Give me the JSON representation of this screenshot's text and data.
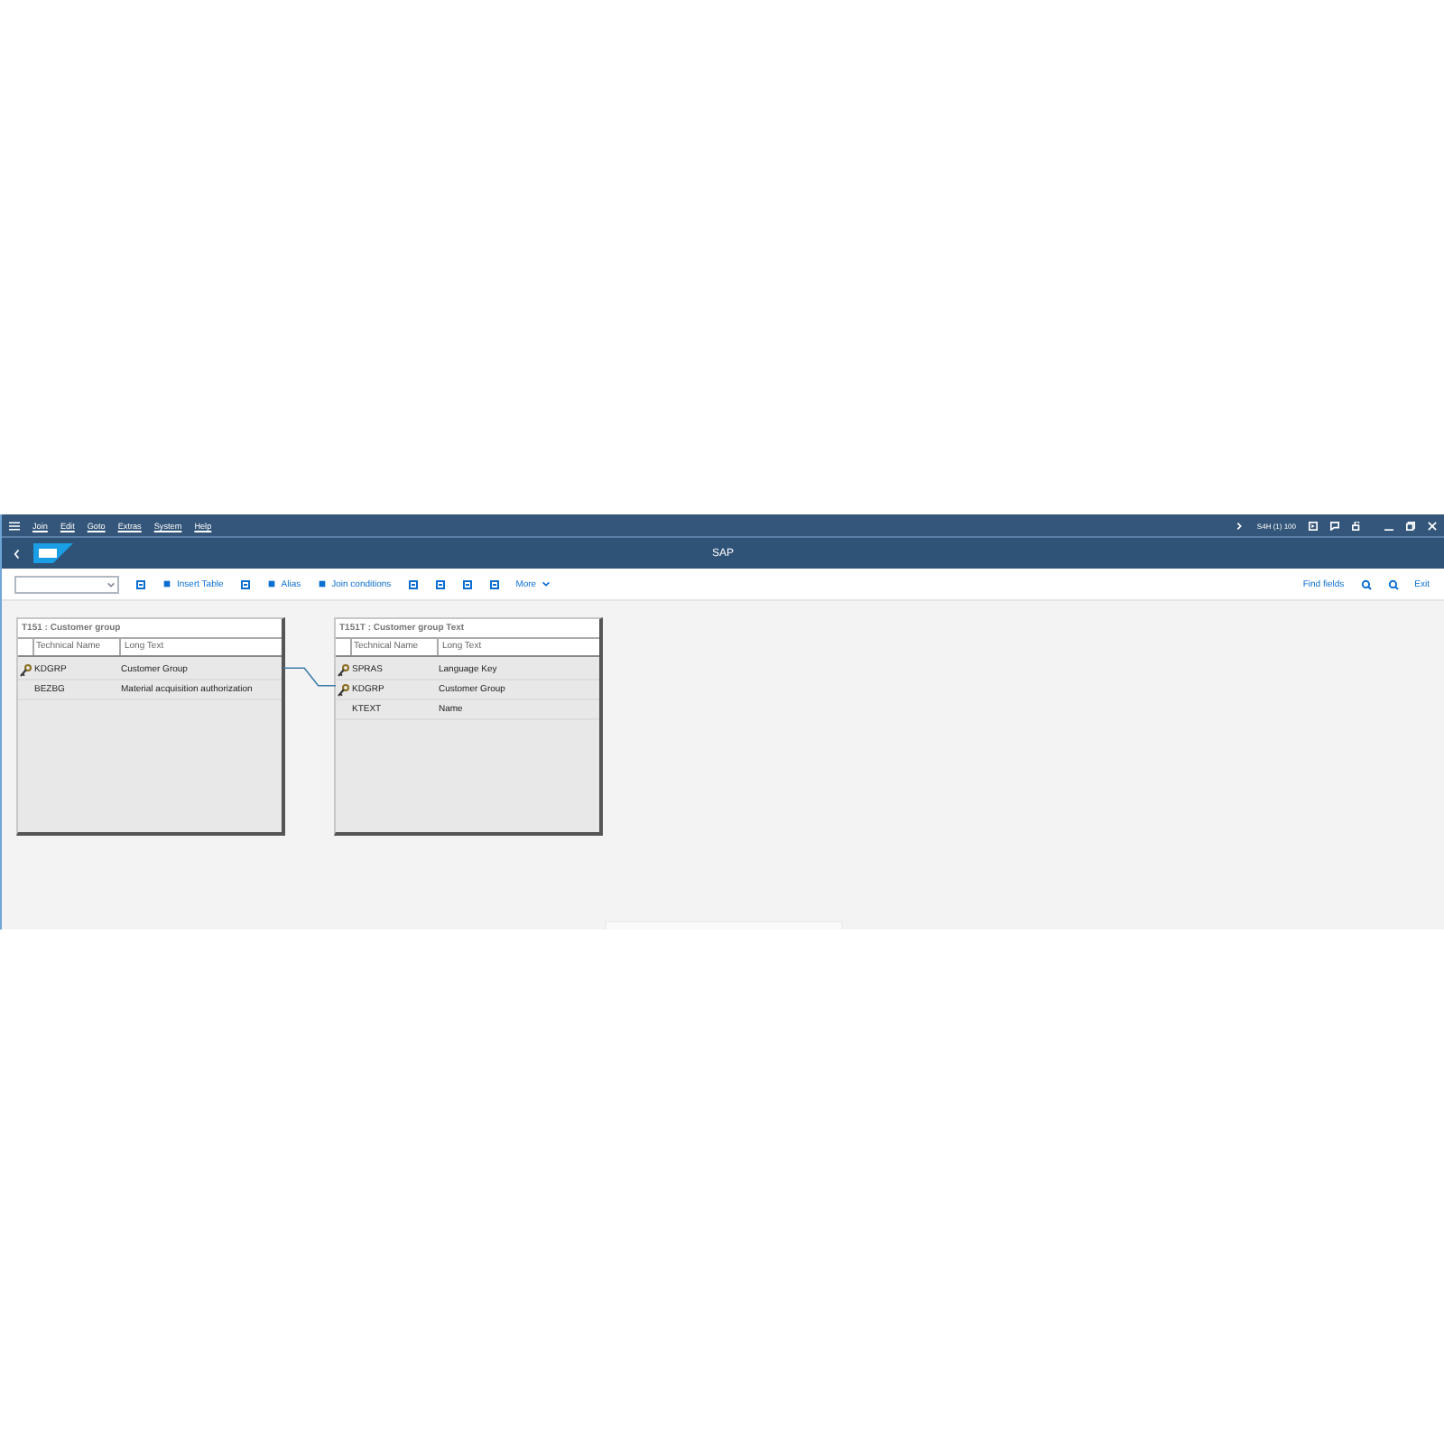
{
  "menu": [
    "Join",
    "Edit",
    "Goto",
    "Extras",
    "System",
    "Help"
  ],
  "system": "S4H (1) 100",
  "title": "SAP",
  "toolbar": {
    "left": [
      {
        "kind": "dropdown"
      },
      {
        "kind": "icon"
      },
      {
        "kind": "button",
        "label": "Insert Table"
      },
      {
        "kind": "icon"
      },
      {
        "kind": "button",
        "label": "Alias"
      },
      {
        "kind": "button",
        "label": "Join conditions"
      },
      {
        "kind": "icon"
      },
      {
        "kind": "icon"
      },
      {
        "kind": "icon"
      },
      {
        "kind": "icon"
      },
      {
        "kind": "menu",
        "label": "More"
      }
    ],
    "right": [
      {
        "kind": "button",
        "label": "Find fields"
      },
      {
        "kind": "icon"
      },
      {
        "kind": "icon"
      },
      {
        "kind": "button",
        "label": "Exit"
      }
    ]
  },
  "tables": [
    {
      "title": "T151 : Customer group",
      "columns": [
        "Technical Name",
        "Long Text"
      ],
      "rows": [
        {
          "name": "KDGRP",
          "text": "Customer Group",
          "key": true
        },
        {
          "name": "BEZBG",
          "text": "Material acquisition authorization",
          "key": false
        }
      ]
    },
    {
      "title": "T151T : Customer group Text",
      "columns": [
        "Technical Name",
        "Long Text"
      ],
      "rows": [
        {
          "name": "SPRAS",
          "text": "Language Key",
          "key": true
        },
        {
          "name": "KDGRP",
          "text": "Customer Group",
          "key": true
        },
        {
          "name": "KTEXT",
          "text": "Name",
          "key": false
        }
      ]
    }
  ]
}
